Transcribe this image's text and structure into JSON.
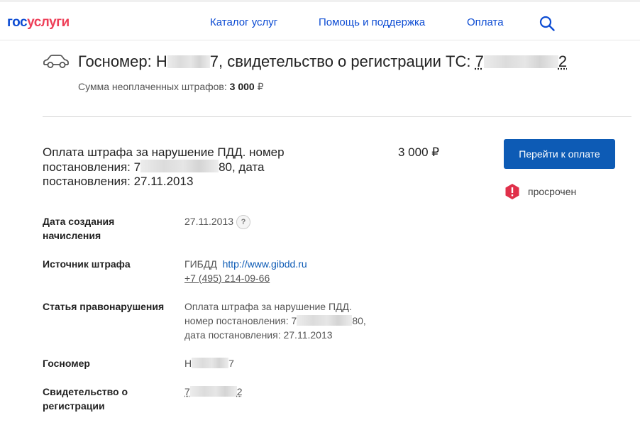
{
  "header": {
    "logo_part1": "гос",
    "logo_part2": "услуги",
    "nav": [
      "Каталог услуг",
      "Помощь и поддержка",
      "Оплата"
    ],
    "search_icon": "search-icon"
  },
  "vehicle": {
    "title_prefix": "Госномер: Н",
    "title_mid": "7, свидетельство о регистрации ТС: ",
    "reg_start": "7",
    "reg_end": "2",
    "summary_label": "Сумма неоплаченных штрафов: ",
    "summary_value": "3 000",
    "currency": "₽"
  },
  "fine": {
    "desc_part1": "Оплата штрафа за нарушение ПДД. номер постановления: 7",
    "desc_part2": "80, дата постановления: 27.11.2013",
    "amount": "3 000 ₽",
    "pay_button": "Перейти к оплате",
    "status": "просрочен",
    "status_color": "#e0304a"
  },
  "details": {
    "created_label": "Дата создания начисления",
    "created_value": "27.11.2013",
    "help": "?",
    "source_label": "Источник штрафа",
    "source_org": "ГИБДД",
    "source_link": "http://www.gibdd.ru",
    "source_phone": "+7 (495) 214-09-66",
    "article_label": "Статья правонарушения",
    "article_line1": "Оплата штрафа за нарушение ПДД.",
    "article_line2_start": "номер постановления: 7",
    "article_line2_end": "80,",
    "article_line3": "дата постановления: 27.11.2013",
    "plate_label": "Госномер",
    "plate_start": "Н",
    "plate_end": "7",
    "reg_label": "Свидетельство о регистрации",
    "reg_start": "7",
    "reg_end": "2"
  },
  "colors": {
    "brand_blue": "#0d4cd3",
    "brand_red": "#ee3f58",
    "button": "#0d5bb5"
  }
}
